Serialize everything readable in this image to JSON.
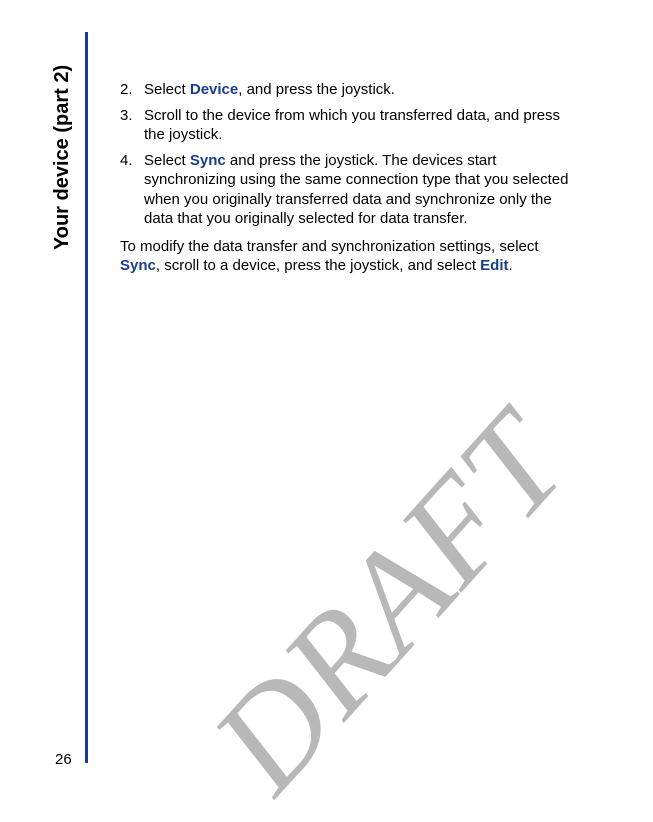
{
  "sideTitle": "Your device (part 2)",
  "pageNumber": "26",
  "watermark": "DRAFT",
  "steps": [
    {
      "num": "2.",
      "before": "Select ",
      "hl": "Device",
      "after": ", and press the joystick."
    },
    {
      "num": "3.",
      "before": "Scroll to the device from which you transferred data, and press the joystick.",
      "hl": "",
      "after": ""
    },
    {
      "num": "4.",
      "before": "Select ",
      "hl": "Sync",
      "after": " and press the joystick. The devices start synchronizing using the same connection type that you selected when you originally transferred data and synchronize only the data that you originally selected for data transfer."
    }
  ],
  "paragraph": {
    "p1": "To modify the data transfer and synchronization settings, select ",
    "hl1": "Sync",
    "p2": ", scroll to a device, press the joystick, and select ",
    "hl2": "Edit",
    "p3": "."
  }
}
